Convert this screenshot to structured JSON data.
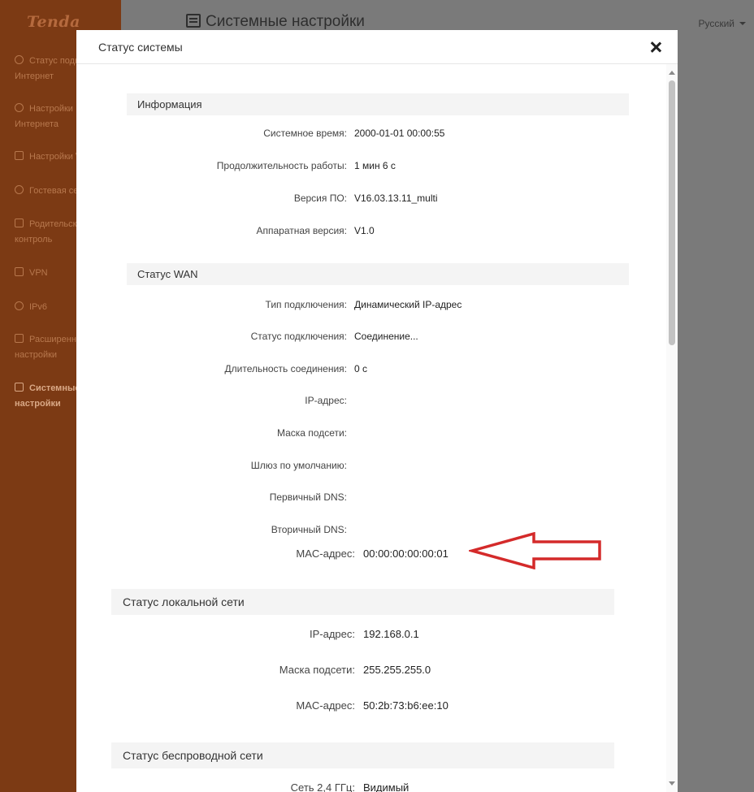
{
  "brand": "Tenda",
  "sidebar": {
    "items": [
      {
        "line1": "Статус подк",
        "line2": "Интернет"
      },
      {
        "line1": "Настройки",
        "line2": "Интернета"
      },
      {
        "line1": "Настройки \\",
        "line2": ""
      },
      {
        "line1": "Гостевая се",
        "line2": ""
      },
      {
        "line1": "Родительск",
        "line2": "контроль"
      },
      {
        "line1": "VPN",
        "line2": ""
      },
      {
        "line1": "IPv6",
        "line2": ""
      },
      {
        "line1": "Расширенн",
        "line2": "настройки"
      },
      {
        "line1": "Системные",
        "line2": "настройки"
      }
    ]
  },
  "header": {
    "title": "Системные настройки",
    "language": "Русский"
  },
  "modal": {
    "title": "Статус системы",
    "sections": {
      "info": {
        "title": "Информация",
        "rows": [
          {
            "label": "Системное время:",
            "value": "2000-01-01 00:00:55"
          },
          {
            "label": "Продолжительность работы:",
            "value": "1 мин 6 с"
          },
          {
            "label": "Версия ПО:",
            "value": "V16.03.13.11_multi"
          },
          {
            "label": "Аппаратная версия:",
            "value": "V1.0"
          }
        ]
      },
      "wan": {
        "title": "Статус WAN",
        "rows": [
          {
            "label": "Тип подключения:",
            "value": "Динамический IP-адрес"
          },
          {
            "label": "Статус подключения:",
            "value": "Соединение..."
          },
          {
            "label": "Длительность соединения:",
            "value": "0 с"
          },
          {
            "label": "IP-адрес:",
            "value": ""
          },
          {
            "label": "Маска подсети:",
            "value": ""
          },
          {
            "label": "Шлюз по умолчанию:",
            "value": ""
          },
          {
            "label": "Первичный DNS:",
            "value": ""
          },
          {
            "label": "Вторичный DNS:",
            "value": ""
          },
          {
            "label": "MAC-адрес:",
            "value": "00:00:00:00:00:01"
          }
        ]
      },
      "lan": {
        "title": "Статус локальной сети",
        "rows": [
          {
            "label": "IP-адрес:",
            "value": "192.168.0.1"
          },
          {
            "label": "Маска подсети:",
            "value": "255.255.255.0"
          },
          {
            "label": "MAC-адрес:",
            "value": "50:2b:73:b6:ee:10"
          }
        ]
      },
      "wireless": {
        "title": "Статус беспроводной сети",
        "rows": [
          {
            "label": "Сеть 2,4 ГГц:",
            "value": "Видимый"
          }
        ]
      }
    }
  },
  "colors": {
    "sidebar_bg": "#7c3a14",
    "overlay_bg": "#7a7a7a",
    "arrow": "#d42a2a",
    "section_bg": "#f4f4f4"
  }
}
